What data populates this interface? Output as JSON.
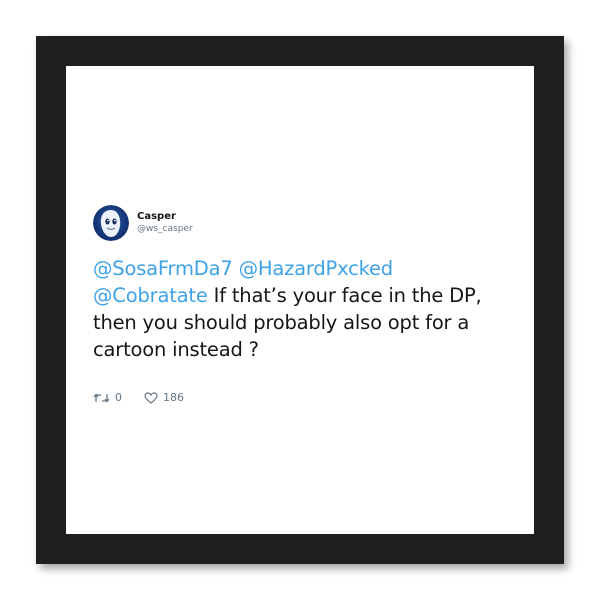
{
  "tweet": {
    "author": {
      "display_name": "Casper",
      "handle": "@ws_casper",
      "avatar_icon": "casper-ghost-avatar"
    },
    "text": {
      "mention_1": "@SosaFrmDa7",
      "mention_2": "@HazardPxcked",
      "mention_3": "@Cobratate",
      "line_1_rest": "If that’s your face in the DP,",
      "line_2": "then you should probably also opt for a",
      "line_3": "cartoon instead ?"
    },
    "stats": {
      "retweets": "0",
      "likes": "186"
    }
  },
  "colors": {
    "frame": "#1f1f1f",
    "mat": "#ffffff",
    "mention": "#3ea2e6",
    "text": "#14171a",
    "muted": "#657786"
  }
}
